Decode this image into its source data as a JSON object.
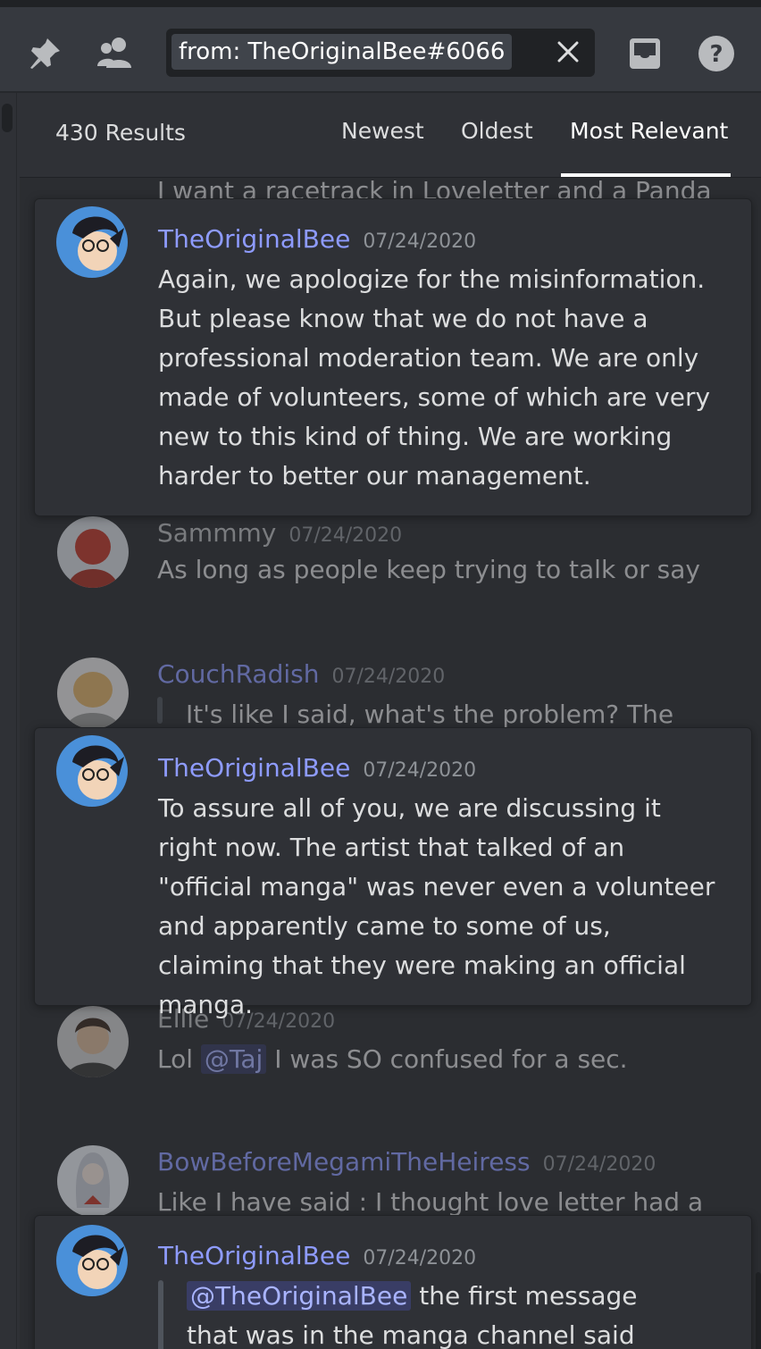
{
  "search": {
    "query": "from: TheOriginalBee#6066"
  },
  "results": {
    "count_label": "430 Results",
    "sort_tabs": [
      {
        "label": "Newest",
        "active": false
      },
      {
        "label": "Oldest",
        "active": false
      },
      {
        "label": "Most Relevant",
        "active": true
      }
    ]
  },
  "messages": [
    {
      "author": "",
      "timestamp": "",
      "text": "I want a racetrack in Loveletter and a Panda",
      "context": true
    },
    {
      "author": "TheOriginalBee",
      "timestamp": "07/24/2020",
      "text": "Again, we apologize for the misinformation. But please know that we do not have a professional moderation team. We are only made of volunteers, some of which are very new to this kind of thing. We are working harder to better our management.",
      "context": false
    },
    {
      "author": "Sammmy",
      "timestamp": "07/24/2020",
      "text": "As long as people keep trying to talk or say",
      "context": true
    },
    {
      "author": "CouchRadish",
      "timestamp": "07/24/2020",
      "text": "It's like I said, what's the problem? The",
      "context": true
    },
    {
      "author": "TheOriginalBee",
      "timestamp": "07/24/2020",
      "text": "To assure all of you, we are discussing it right now. The artist that talked of an \"official manga\" was never even a volunteer and apparently came to some of us, claiming that they were making an official manga.",
      "context": false
    },
    {
      "author": "Ellie",
      "timestamp": "07/24/2020",
      "text_before": "Lol ",
      "mention": "@Taj",
      "text_after": " I was SO confused for a sec.",
      "context": true
    },
    {
      "author": "BowBeforeMegamiTheHeiress",
      "timestamp": "07/24/2020",
      "text": "Like I have said : I thought love letter had a",
      "context": true
    },
    {
      "author": "TheOriginalBee",
      "timestamp": "07/24/2020",
      "mention": "@TheOriginalBee",
      "text_after": " the first message",
      "text_line2": "that was in the manga channel said",
      "context": false
    }
  ],
  "icons": {
    "pin": "pin-icon",
    "members": "members-icon",
    "clear": "close-icon",
    "inbox": "inbox-icon",
    "help": "help-icon"
  },
  "colors": {
    "accent": "#8e9bff",
    "background": "#2f3136",
    "toolbar": "#36393f"
  }
}
